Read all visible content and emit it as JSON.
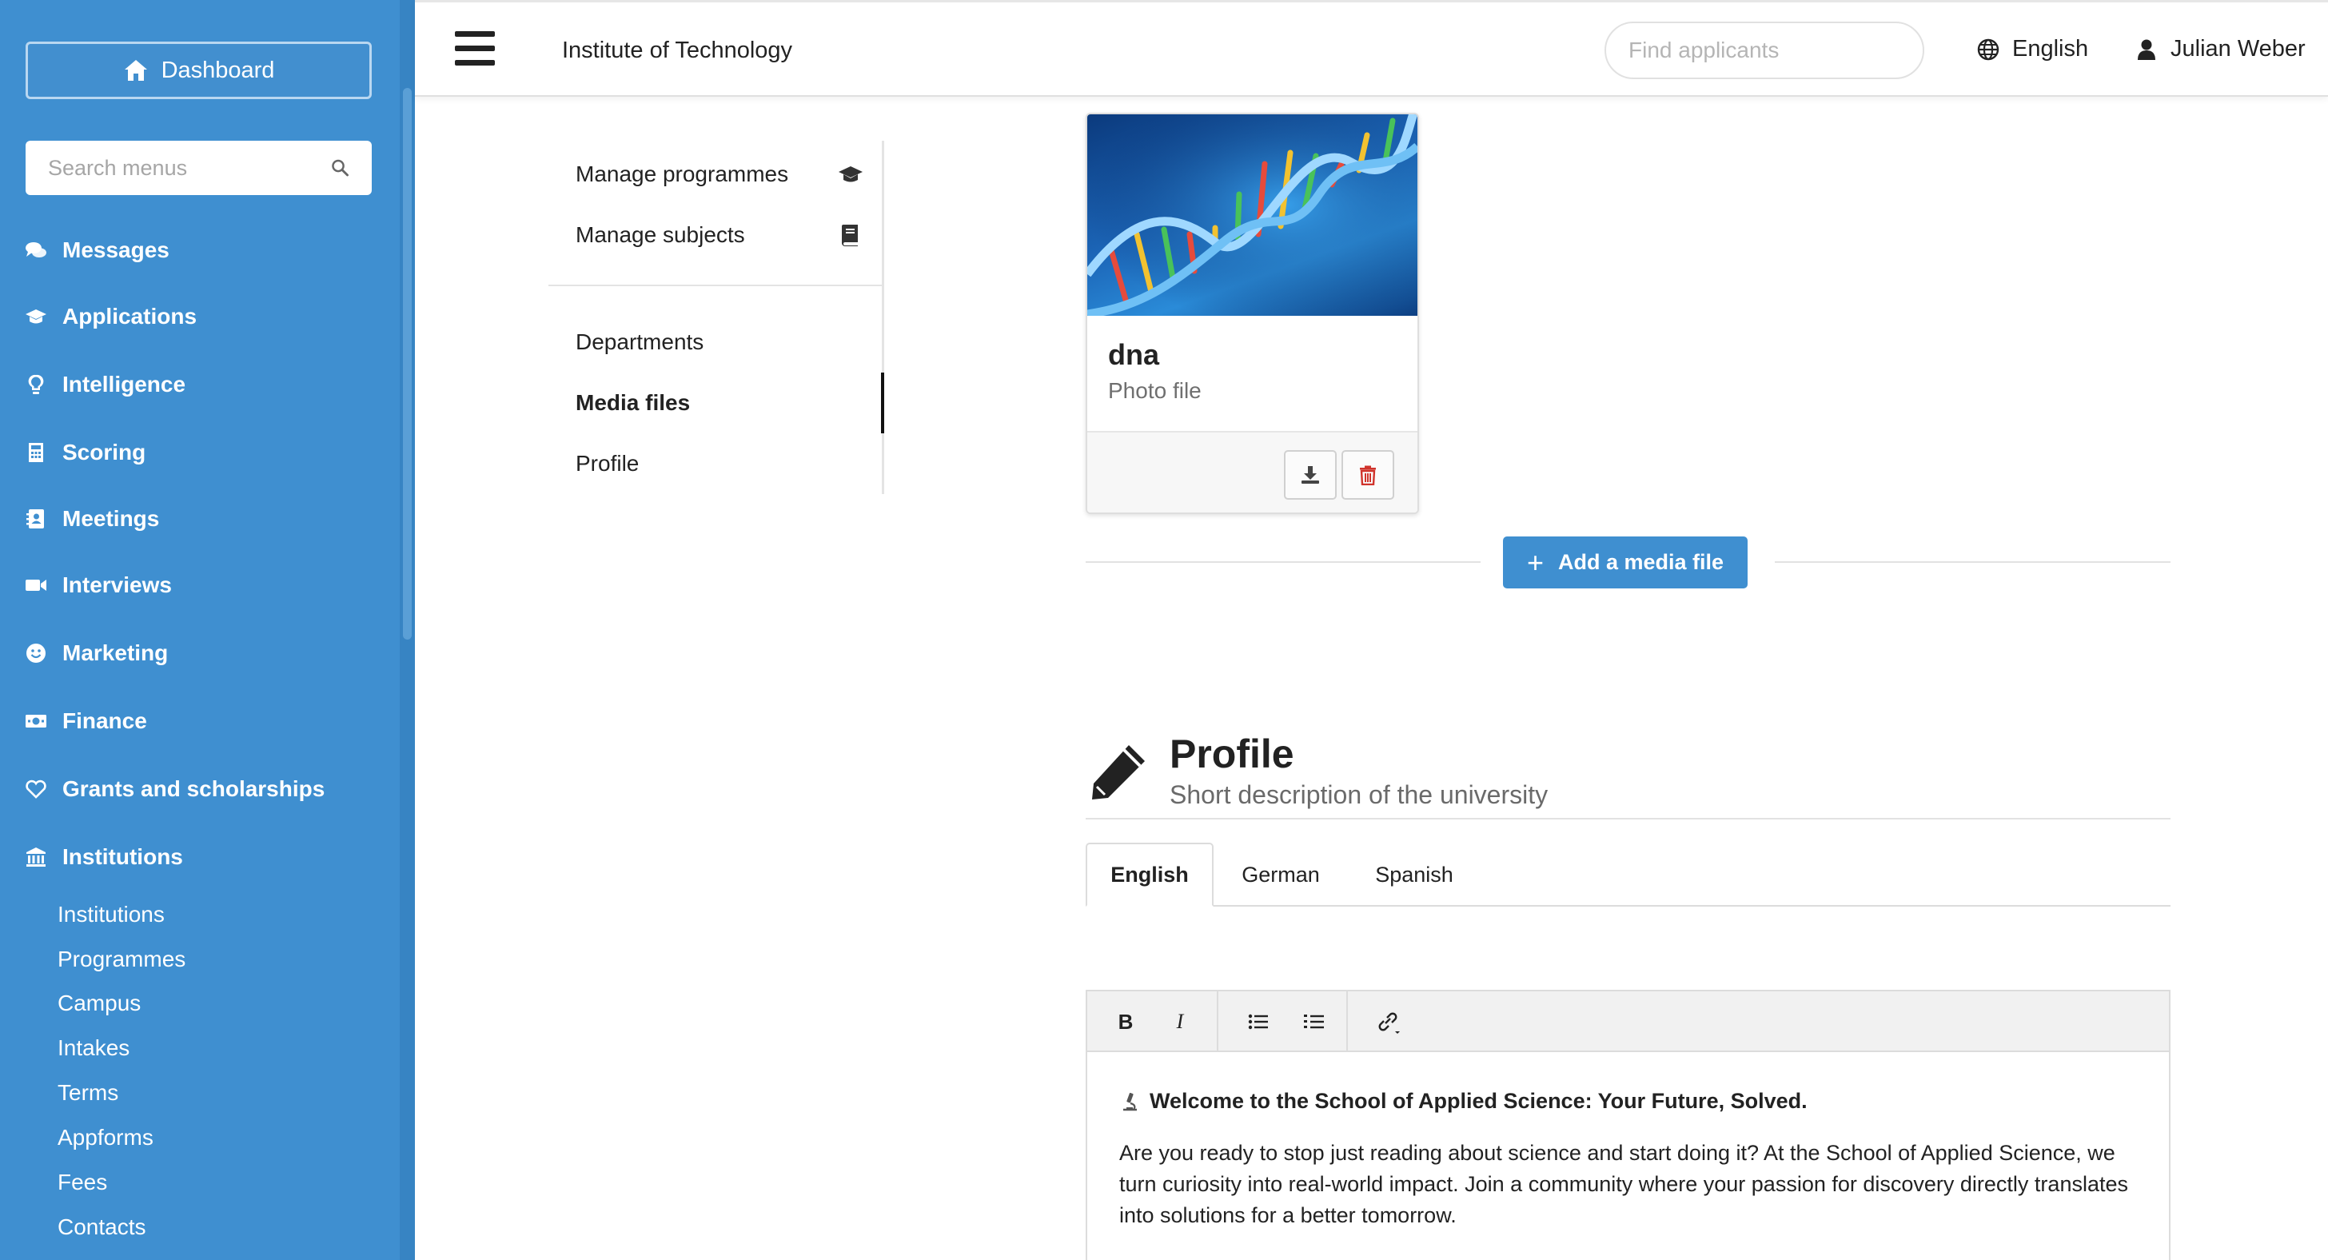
{
  "sidebar": {
    "dashboard_label": "Dashboard",
    "search_placeholder": "Search menus",
    "items": [
      {
        "label": "Messages",
        "icon": "comments-icon"
      },
      {
        "label": "Applications",
        "icon": "graduation-cap-icon"
      },
      {
        "label": "Intelligence",
        "icon": "lightbulb-icon"
      },
      {
        "label": "Scoring",
        "icon": "calculator-icon"
      },
      {
        "label": "Meetings",
        "icon": "address-book-icon"
      },
      {
        "label": "Interviews",
        "icon": "video-icon"
      },
      {
        "label": "Marketing",
        "icon": "smile-icon"
      },
      {
        "label": "Finance",
        "icon": "money-icon"
      },
      {
        "label": "Grants and scholarships",
        "icon": "heart-icon"
      },
      {
        "label": "Institutions",
        "icon": "bank-icon"
      }
    ],
    "sub_items": [
      "Institutions",
      "Programmes",
      "Campus",
      "Intakes",
      "Terms",
      "Appforms",
      "Fees",
      "Contacts"
    ]
  },
  "header": {
    "title": "Institute of Technology",
    "search_placeholder": "Find applicants",
    "language": "English",
    "user": "Julian Weber"
  },
  "subnav": {
    "items": [
      {
        "label": "Manage programmes",
        "icon": "graduation-cap-icon"
      },
      {
        "label": "Manage subjects",
        "icon": "book-icon"
      },
      {
        "label": "Departments"
      },
      {
        "label": "Media files",
        "active": true
      },
      {
        "label": "Profile"
      }
    ]
  },
  "media": {
    "name": "dna",
    "type": "Photo file",
    "add_label": "Add a media file"
  },
  "profile": {
    "title": "Profile",
    "subtitle": "Short description of the university",
    "tabs": [
      "English",
      "German",
      "Spanish"
    ],
    "active_tab": "English",
    "toolbar": {
      "bold": "B",
      "italic": "I"
    },
    "heading": "Welcome to the School of Applied Science: Your Future, Solved.",
    "body": "Are you ready to stop just reading about science and start doing it? At the School of Applied Science, we turn curiosity into real-world impact. Join a community where your passion for discovery directly translates into solutions for a better tomorrow."
  },
  "colors": {
    "sidebar_bg": "#3f8fd0",
    "primary_button": "#3f8fd0",
    "delete_icon": "#d0342c"
  }
}
